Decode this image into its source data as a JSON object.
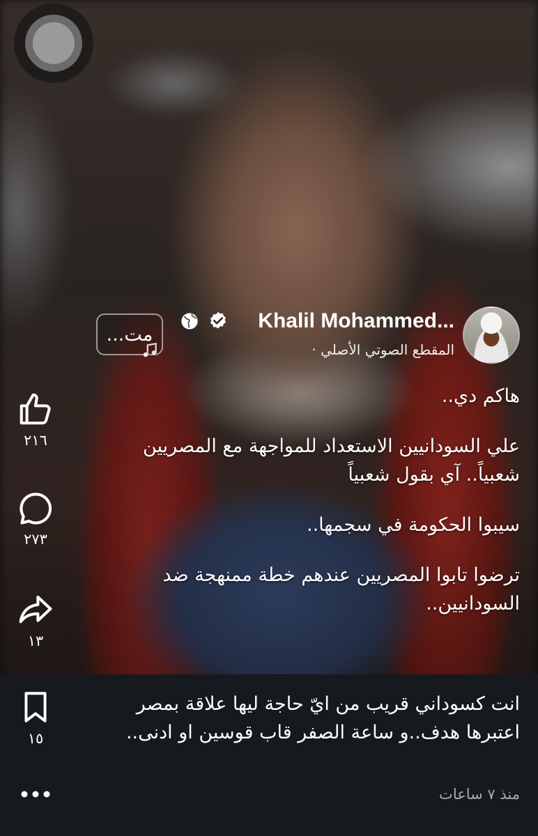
{
  "author": {
    "name": "Khalil Mohammed...",
    "audio_label": "المقطع الصوتي الأصلي ·"
  },
  "more_button": "مت...",
  "caption": {
    "paragraphs": [
      "هاكم دي..",
      "علي السودانيين الاستعداد للمواجهة مع المصريين شعبياً.. آي بقول شعبياً",
      "سيبوا الحكومة في سجمها..",
      "ترضوا تابوا المصريين عندهم خطة ممنهجة ضد السودانيين.."
    ],
    "continuation": "انت كسوداني قريب من ايّ حاجة ليها علاقة بمصر اعتبرها هدف..و ساعة الصفر قاب قوسين او ادنى.."
  },
  "actions": {
    "likes": "٢١٦",
    "comments": "٢٧٣",
    "shares": "١٣",
    "saves": "١٥"
  },
  "timestamp": "منذ ٧ ساعات",
  "icons": {
    "like": "thumbs-up-icon",
    "comment": "comment-bubble-icon",
    "share": "share-arrow-icon",
    "save": "bookmark-icon",
    "more": "more-dots-icon",
    "verified": "verified-badge-icon",
    "globe": "globe-icon",
    "music": "music-note-icon"
  }
}
